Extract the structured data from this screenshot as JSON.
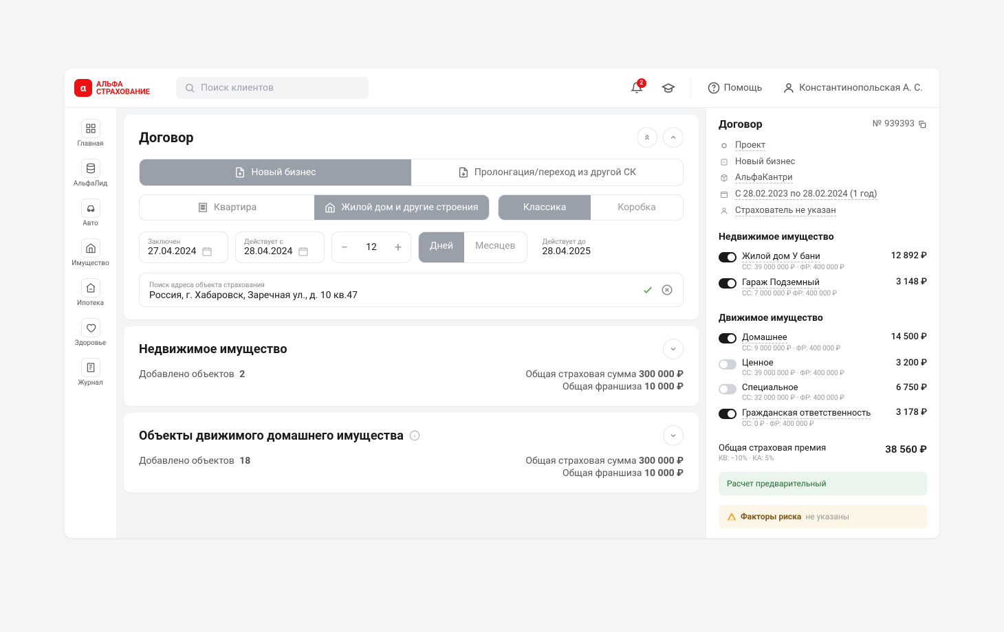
{
  "brand": {
    "name": "АЛЬФА\nСТРАХОВАНИЕ",
    "mark": "α"
  },
  "search": {
    "placeholder": "Поиск клиентов"
  },
  "notifications": {
    "count": 2
  },
  "header": {
    "help": "Помощь",
    "user": "Константинопольская А. С."
  },
  "sidebar": [
    {
      "label": "Главная",
      "icon": "grid"
    },
    {
      "label": "АльфаЛид",
      "icon": "db"
    },
    {
      "label": "Авто",
      "icon": "car"
    },
    {
      "label": "Имущество",
      "icon": "house"
    },
    {
      "label": "Ипотека",
      "icon": "mortgage"
    },
    {
      "label": "Здоровье",
      "icon": "heart"
    },
    {
      "label": "Журнал",
      "icon": "journal"
    }
  ],
  "contract": {
    "title": "Договор",
    "business_tabs": {
      "new": "Новый бизнес",
      "prolong": "Пролонгация/переход из другой СК"
    },
    "type_tabs": {
      "apartment": "Квартира",
      "house": "Жилой дом и другие строения"
    },
    "class_tabs": {
      "classic": "Классика",
      "box": "Коробка"
    },
    "dates": {
      "concluded_label": "Заключен",
      "concluded": "27.04.2024",
      "start_label": "Действует с",
      "start": "28.04.2024",
      "duration": "12",
      "unit_days": "Дней",
      "unit_months": "Месяцев",
      "until_label": "Действует до",
      "until": "28.04.2025"
    },
    "address": {
      "label": "Поиск адреса объекта страхования",
      "value": "Россия, г. Хабаровск, Заречная ул., д. 10 кв.47"
    }
  },
  "sections": {
    "immovable": {
      "title": "Недвижимое имущество",
      "added_label": "Добавлено объектов",
      "added_count": "2",
      "sum_label": "Общая страховая сумма",
      "sum_value": "300 000 ₽",
      "fr_label": "Общая франшиза",
      "fr_value": "10 000 ₽"
    },
    "movable": {
      "title": "Объекты движимого домашнего имущества",
      "added_label": "Добавлено объектов",
      "added_count": "18",
      "sum_label": "Общая страховая сумма",
      "sum_value": "300 000 ₽",
      "fr_label": "Общая франшиза",
      "fr_value": "10 000 ₽"
    }
  },
  "rpanel": {
    "title": "Договор",
    "number_prefix": "№",
    "number": "939393",
    "status": "Проект",
    "business": "Новый бизнес",
    "product": "АльфаКантри",
    "period": "С 28.02.2023 по 28.02.2024 (1 год)",
    "insurer": "Страхователь не указан",
    "immovable_title": "Недвижимое имущество",
    "immovable": [
      {
        "title": "Жилой дом У бани",
        "sub": "СС: 39 000 000 ₽ · ФР: 400 000 ₽",
        "val": "12 892 ₽",
        "on": true
      },
      {
        "title": "Гараж Подземный",
        "sub": "СС: 7 000 000 ₽  ФР: 400 000 ₽",
        "val": "3 148 ₽",
        "on": true
      }
    ],
    "movable_title": "Движимое имущество",
    "movable": [
      {
        "title": "Домашнее",
        "sub": "СС: 9 000 000 ₽ · ФР: 400 000 ₽",
        "val": "14 500 ₽",
        "on": true
      },
      {
        "title": "Ценное",
        "sub": "СС: 39 000 000 ₽ · ФР: 400 000 ₽",
        "val": "3 200 ₽",
        "on": false
      },
      {
        "title": "Специальное",
        "sub": "СС: 32 000 000 ₽ · ФР: 400 000 ₽",
        "val": "6 750 ₽",
        "on": false
      }
    ],
    "liability": {
      "title": "Гражданская ответственность",
      "sub": "СС: 0 ₽ · ФР: 400 000 ₽",
      "val": "3 178 ₽",
      "on": true
    },
    "total_label": "Общая страховая премия",
    "total_val": "38 560 ₽",
    "total_sub": "КВ: −10% · КА: 5%",
    "banner_green": "Расчет предварительный",
    "banner_amber_bold": "Факторы риска",
    "banner_amber_rest": "не указаны"
  }
}
